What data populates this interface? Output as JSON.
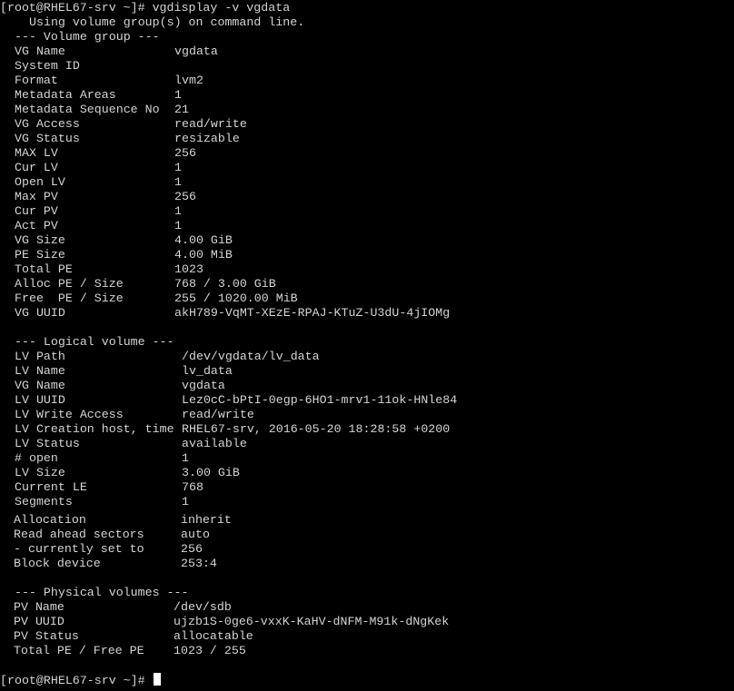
{
  "terminal": {
    "prompt": "[root@RHEL67-srv ~]# ",
    "command": "vgdisplay -v vgdata",
    "info_line": "Using volume group(s) on command line.",
    "vg_header": "--- Volume group ---",
    "vg_rows": [
      {
        "key": "VG Name",
        "value": "vgdata"
      },
      {
        "key": "System ID",
        "value": ""
      },
      {
        "key": "Format",
        "value": "lvm2"
      },
      {
        "key": "Metadata Areas",
        "value": "1"
      },
      {
        "key": "Metadata Sequence No",
        "value": "21"
      },
      {
        "key": "VG Access",
        "value": "read/write"
      },
      {
        "key": "VG Status",
        "value": "resizable"
      },
      {
        "key": "MAX LV",
        "value": "256"
      },
      {
        "key": "Cur LV",
        "value": "1"
      },
      {
        "key": "Open LV",
        "value": "1"
      },
      {
        "key": "Max PV",
        "value": "256"
      },
      {
        "key": "Cur PV",
        "value": "1"
      },
      {
        "key": "Act PV",
        "value": "1"
      },
      {
        "key": "VG Size",
        "value": "4.00 GiB"
      },
      {
        "key": "PE Size",
        "value": "4.00 MiB"
      },
      {
        "key": "Total PE",
        "value": "1023"
      },
      {
        "key": "Alloc PE / Size",
        "value": "768 / 3.00 GiB"
      },
      {
        "key": "Free  PE / Size",
        "value": "255 / 1020.00 MiB"
      },
      {
        "key": "VG UUID",
        "value": "akH789-VqMT-XEzE-RPAJ-KTuZ-U3dU-4jIOMg"
      }
    ],
    "lv_header": "--- Logical volume ---",
    "lv_rows": [
      {
        "key": "LV Path",
        "value": "/dev/vgdata/lv_data"
      },
      {
        "key": "LV Name",
        "value": "lv_data"
      },
      {
        "key": "VG Name",
        "value": "vgdata"
      },
      {
        "key": "LV UUID",
        "value": "Lez0cC-bPtI-0egp-6HO1-mrv1-11ok-HNle84"
      },
      {
        "key": "LV Write Access",
        "value": "read/write"
      },
      {
        "key": "LV Creation host, time",
        "value": "RHEL67-srv, 2016-05-20 18:28:58 +0200"
      },
      {
        "key": "LV Status",
        "value": "available"
      },
      {
        "key": "# open",
        "value": "1"
      },
      {
        "key": "LV Size",
        "value": "3.00 GiB"
      },
      {
        "key": "Current LE",
        "value": "768"
      },
      {
        "key": "Segments",
        "value": "1"
      }
    ],
    "lv_rows_2": [
      {
        "key": "Allocation",
        "value": "inherit"
      },
      {
        "key": "Read ahead sectors",
        "value": "auto"
      },
      {
        "key": "- currently set to",
        "value": "256"
      },
      {
        "key": "Block device",
        "value": "253:4"
      }
    ],
    "pv_header": "--- Physical volumes ---",
    "pv_rows": [
      {
        "key": "PV Name",
        "value": "/dev/sdb"
      },
      {
        "key": "PV UUID",
        "value": "ujzb1S-0ge6-vxxK-KaHV-dNFM-M91k-dNgKek"
      },
      {
        "key": "PV Status",
        "value": "allocatable"
      },
      {
        "key": "Total PE / Free PE",
        "value": "1023 / 255"
      }
    ],
    "final_prompt": "[root@RHEL67-srv ~]# ",
    "colors": {
      "background": "#000000",
      "foreground": "#d4d4d4",
      "cursor": "#ffffff"
    }
  }
}
